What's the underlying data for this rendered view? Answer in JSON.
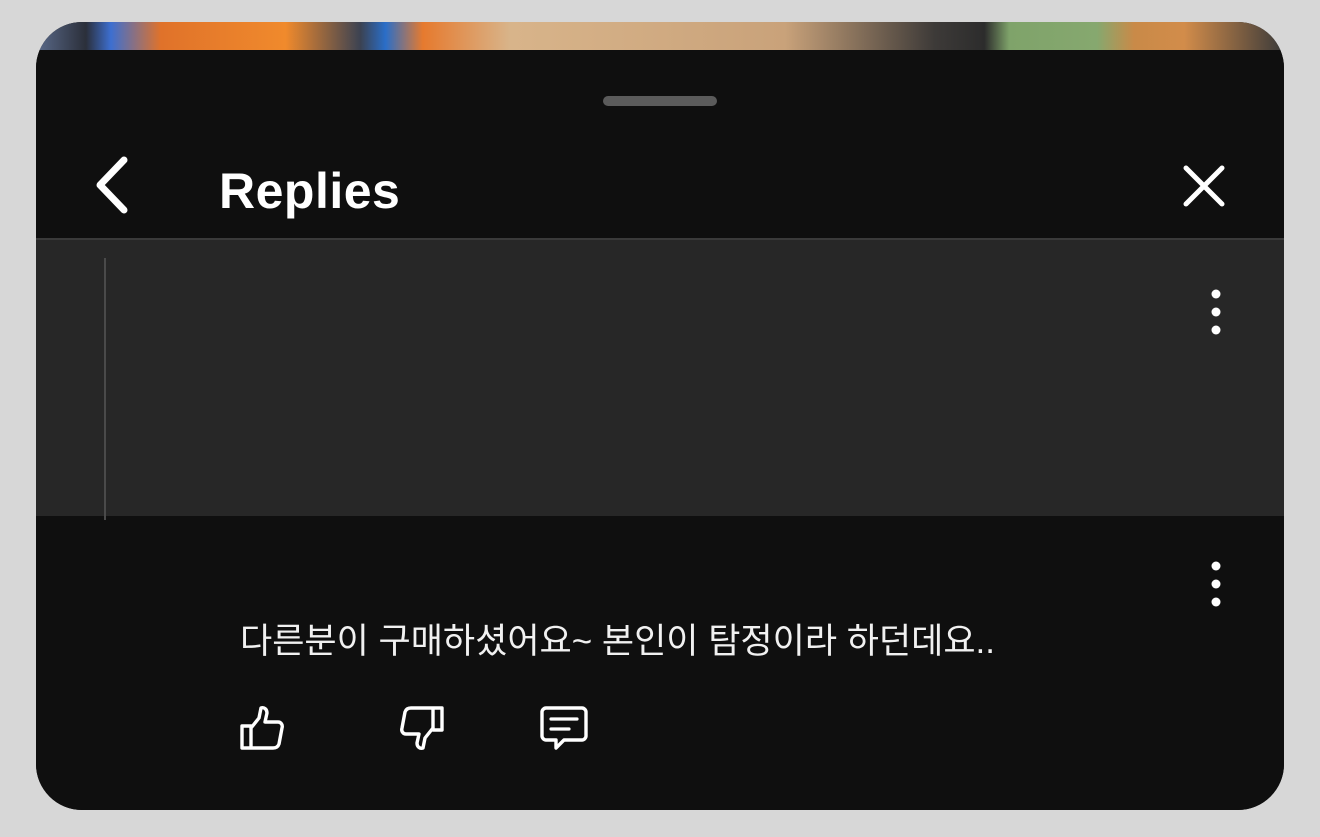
{
  "header": {
    "title": "Replies",
    "back_icon": "chevron-left-icon",
    "close_icon": "close-icon"
  },
  "parent_comment": {
    "more_icon": "more-vertical-icon"
  },
  "reply": {
    "text": "다른분이 구매하셨어요~ 본인이 탐정이라 하던데요..",
    "more_icon": "more-vertical-icon",
    "actions": {
      "like_icon": "thumbs-up-icon",
      "dislike_icon": "thumbs-down-icon",
      "reply_icon": "comment-icon"
    }
  },
  "colors": {
    "sheet_background": "#0f0f0f",
    "parent_comment_background": "#272727",
    "text": "#ffffff",
    "grabber": "#5b5b5b"
  }
}
